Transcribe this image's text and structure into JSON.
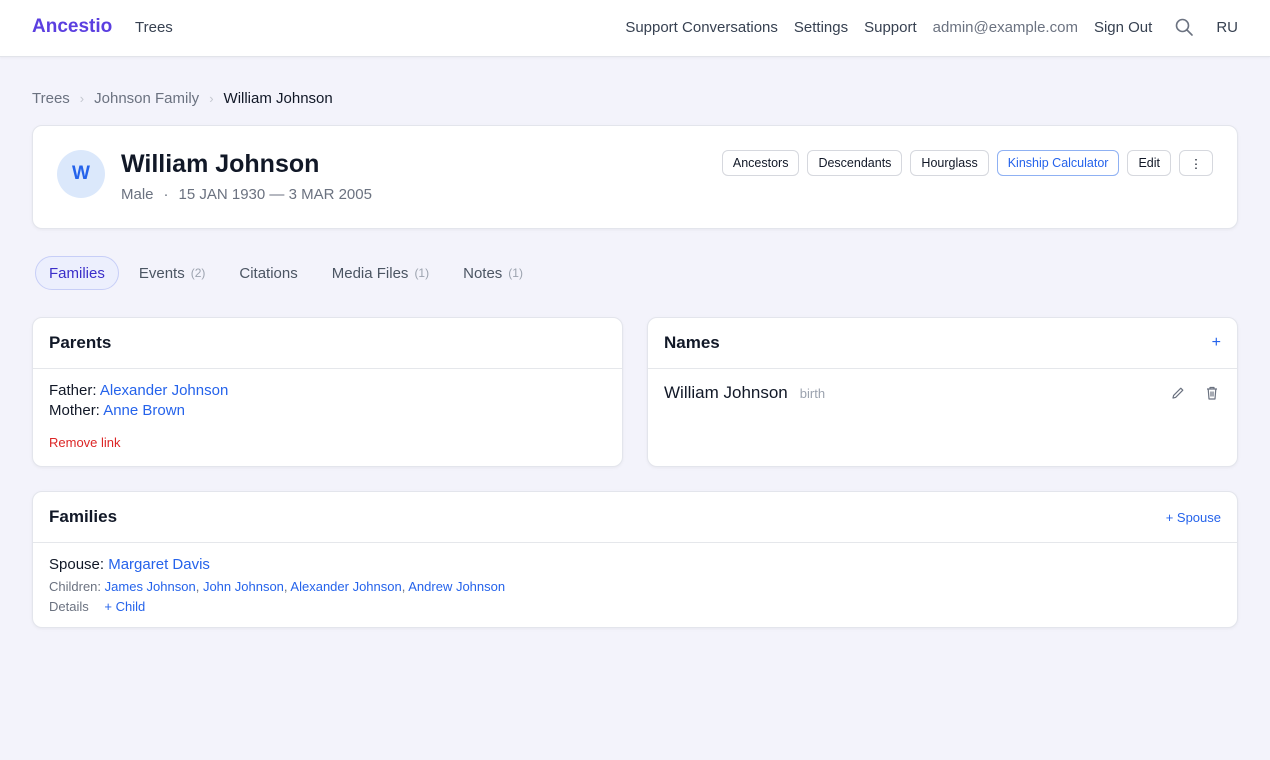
{
  "app": {
    "brand": "Ancestio",
    "nav_trees": "Trees"
  },
  "topnav": {
    "support_conversations": "Support Conversations",
    "settings": "Settings",
    "support": "Support",
    "email": "admin@example.com",
    "sign_out": "Sign Out",
    "lang": "RU"
  },
  "breadcrumb": [
    "Trees",
    "Johnson Family",
    "William Johnson"
  ],
  "person": {
    "initial": "W",
    "name": "William Johnson",
    "gender": "Male",
    "dates": "15 JAN 1930 — 3 MAR 2005",
    "buttons": {
      "ancestors": "Ancestors",
      "descendants": "Descendants",
      "hourglass": "Hourglass",
      "kinship": "Kinship Calculator",
      "edit": "Edit",
      "more": "⋮"
    }
  },
  "tabs": [
    {
      "label": "Families",
      "count": ""
    },
    {
      "label": "Events",
      "count": "(2)"
    },
    {
      "label": "Citations",
      "count": ""
    },
    {
      "label": "Media Files",
      "count": "(1)"
    },
    {
      "label": "Notes",
      "count": "(1)"
    }
  ],
  "parents": {
    "title": "Parents",
    "father_label": "Father:",
    "father": "Alexander Johnson",
    "mother_label": "Mother:",
    "mother": "Anne Brown",
    "remove_link": "Remove link"
  },
  "names": {
    "title": "Names",
    "add": "+",
    "items": [
      {
        "name": "William Johnson",
        "type": "birth"
      }
    ]
  },
  "families": {
    "title": "Families",
    "add_spouse": "+ Spouse",
    "spouse_label": "Spouse:",
    "spouse": "Margaret Davis",
    "children_label": "Children:",
    "children": [
      "James Johnson",
      "John Johnson",
      "Alexander Johnson",
      "Andrew Johnson"
    ],
    "details": "Details",
    "add_child": "+ Child"
  },
  "colors": {
    "brand": "#5b3fe0",
    "link": "#2563eb",
    "danger": "#dc2626"
  }
}
